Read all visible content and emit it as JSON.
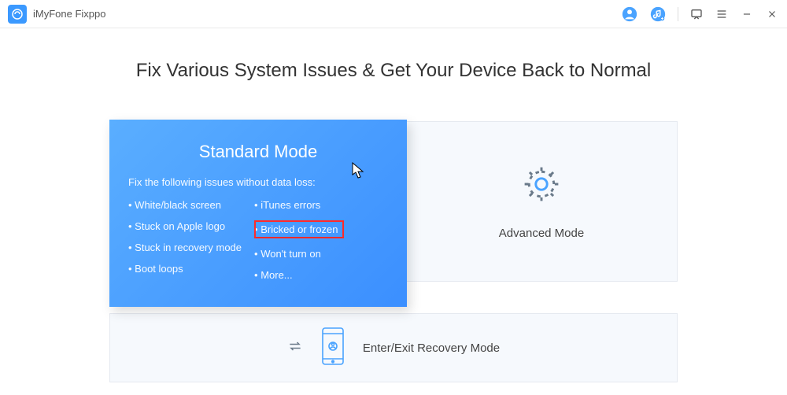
{
  "app": {
    "name": "iMyFone Fixppo"
  },
  "headline": "Fix Various System Issues & Get Your Device Back to Normal",
  "standard": {
    "title": "Standard Mode",
    "subtitle": "Fix the following issues without data loss:",
    "issues_left": [
      "White/black screen",
      "Stuck on Apple logo",
      "Stuck in recovery mode",
      "Boot loops"
    ],
    "issues_right": [
      "iTunes errors",
      "Bricked or frozen",
      "Won't turn on",
      "More..."
    ]
  },
  "advanced": {
    "label": "Advanced Mode"
  },
  "recovery": {
    "label": "Enter/Exit Recovery Mode"
  }
}
